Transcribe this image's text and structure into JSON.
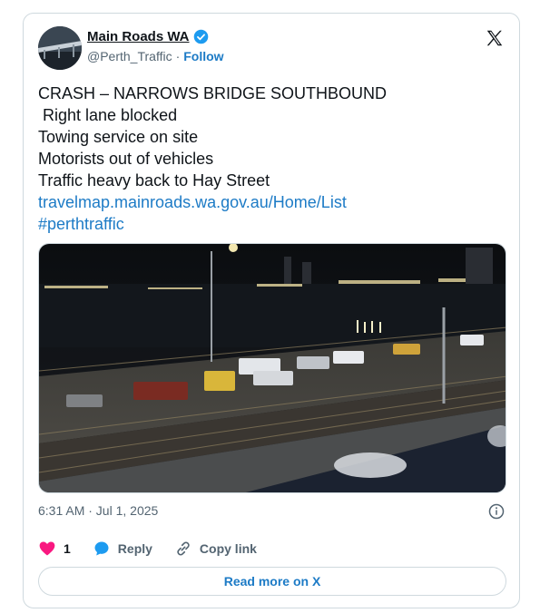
{
  "author": {
    "name": "Main Roads WA",
    "handle": "@Perth_Traffic",
    "separator": "·",
    "follow_label": "Follow"
  },
  "post": {
    "lines": [
      "CRASH – NARROWS BRIDGE SOUTHBOUND",
      " Right lane blocked",
      "Towing service on site",
      "Motorists out of vehicles",
      "Traffic heavy back to Hay Street"
    ],
    "link": "travelmap.mainroads.wa.gov.au/Home/List",
    "hashtag": "#perthtraffic"
  },
  "timestamp": "6:31 AM · Jul 1, 2025",
  "actions": {
    "likes": "1",
    "reply_label": "Reply",
    "copy_label": "Copy link"
  },
  "read_more_label": "Read more on X",
  "colors": {
    "link": "#1d7bc6",
    "like": "#f91880",
    "reply": "#1d9bf0"
  }
}
